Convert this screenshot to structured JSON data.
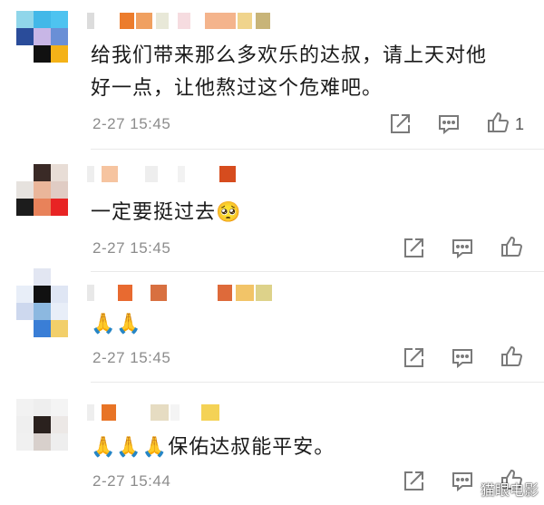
{
  "colors": {
    "text": "#1a1a1a",
    "time": "#8c8c8c",
    "icon": "#7a7a7a",
    "divider": "#e9e9e9"
  },
  "comments": [
    {
      "text_line1": "给我们带来那么多欢乐的达叔，请上天对他",
      "text_line2": "好一点，让他熬过这个危难吧。",
      "time": "2-27 15:45",
      "likes": "1",
      "icons": [
        "share-icon",
        "comment-icon",
        "like-icon"
      ]
    },
    {
      "text": "一定要挺过去",
      "emoji": "🥺",
      "time": "2-27 15:45",
      "icons": [
        "share-icon",
        "comment-icon",
        "like-icon"
      ]
    },
    {
      "emoji": "🙏🙏",
      "time": "2-27 15:45",
      "icons": [
        "share-icon",
        "comment-icon",
        "like-icon"
      ]
    },
    {
      "emoji": "🙏🙏🙏",
      "text": "保佑达叔能平安。",
      "time": "2-27 15:44",
      "icons": [
        "share-icon",
        "comment-icon",
        "like-icon"
      ]
    }
  ],
  "watermark": "猫眼电影"
}
